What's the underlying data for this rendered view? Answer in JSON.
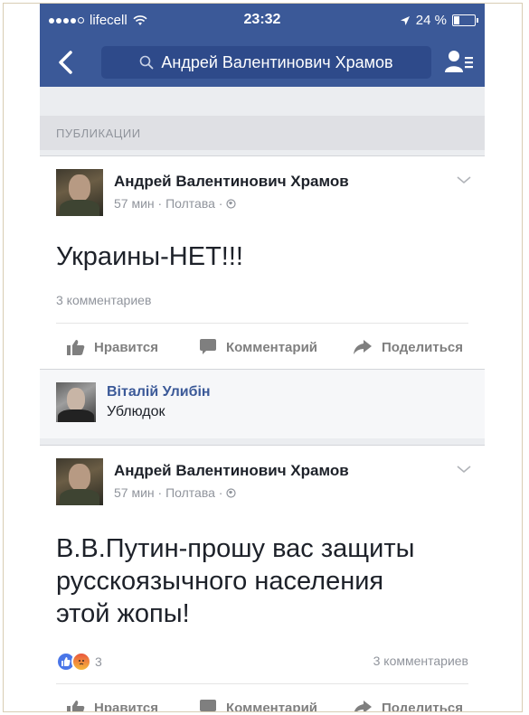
{
  "status_bar": {
    "carrier": "lifecell",
    "time": "23:32",
    "battery": "24 %",
    "battery_level": 0.24
  },
  "header": {
    "search_text": "Андрей Валентинович Храмов"
  },
  "section": {
    "title": "ПУБЛИКАЦИИ"
  },
  "posts": [
    {
      "author": "Андрей Валентинович Храмов",
      "meta": "57 мин · Полтава · ",
      "text": "Украины-НЕТ!!!",
      "comments": "3 комментариев"
    },
    {
      "author": "Андрей Валентинович Храмов",
      "meta": "57 мин · Полтава · ",
      "text_lines": [
        "В.В.Путин-прошу вас защиты",
        "русскоязычного населения",
        "этой жопы!"
      ],
      "reactions_count": "3",
      "comments": "3 комментариев"
    }
  ],
  "comment": {
    "author": "Віталій Улибін",
    "text": "Ублюдок"
  },
  "actions": {
    "like": "Нравится",
    "comment": "Комментарий",
    "share": "Поделиться"
  },
  "colors": {
    "brand": "#3b5998",
    "link": "#3b5998",
    "muted": "#90949c"
  }
}
